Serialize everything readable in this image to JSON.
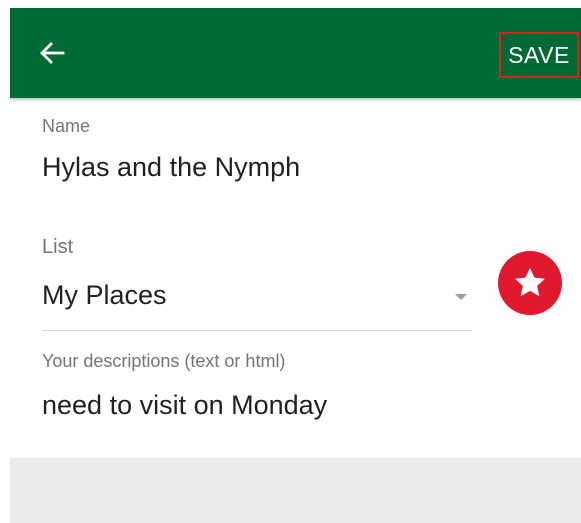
{
  "toolbar": {
    "save_label": "SAVE",
    "back_icon": "arrow-left-icon",
    "bg_color": "#006a34"
  },
  "form": {
    "name_label": "Name",
    "name_value": "Hylas and the Nymph",
    "list_label": "List",
    "list_value": "My Places",
    "description_label": "Your descriptions (text or html)",
    "description_value": "need to visit on Monday"
  },
  "favorite": {
    "icon": "star-icon",
    "color": "#e0192f"
  }
}
